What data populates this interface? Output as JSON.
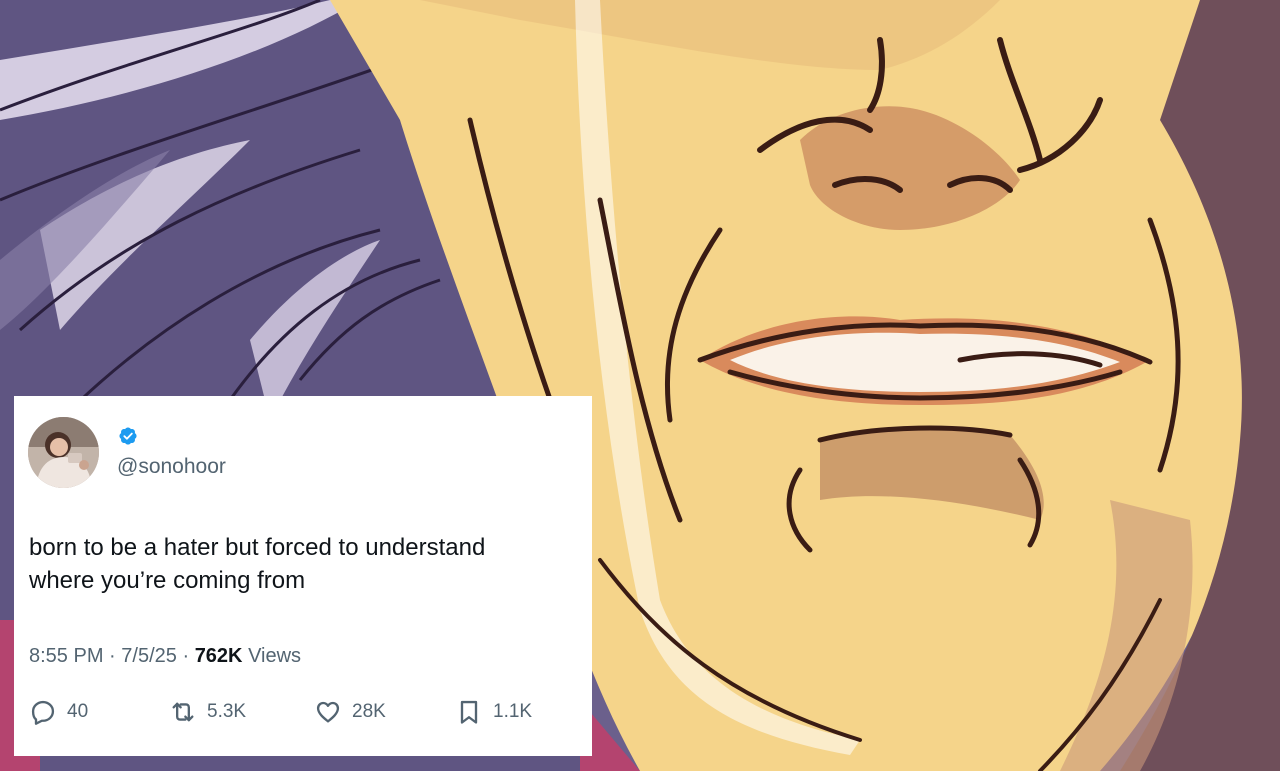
{
  "tweet": {
    "handle": "@sonohoor",
    "verified": true,
    "text_lines": [
      "born to be a hater but forced to understand",
      "where you’re coming from"
    ],
    "time": "8:55 PM",
    "date": "7/5/25",
    "separator": "·",
    "views_count": "762K",
    "views_label": "Views",
    "actions": {
      "replies": "40",
      "reposts": "5.3K",
      "likes": "28K",
      "bookmarks": "1.1K"
    }
  },
  "colors": {
    "badge": "#1d9bf0",
    "text": "#0f1419",
    "muted": "#536471",
    "skin": "#f6d58b",
    "hair": "#6b608c",
    "outline": "#4a2418"
  },
  "icons": [
    "verified-badge-icon",
    "reply-icon",
    "repost-icon",
    "like-icon",
    "bookmark-icon"
  ]
}
